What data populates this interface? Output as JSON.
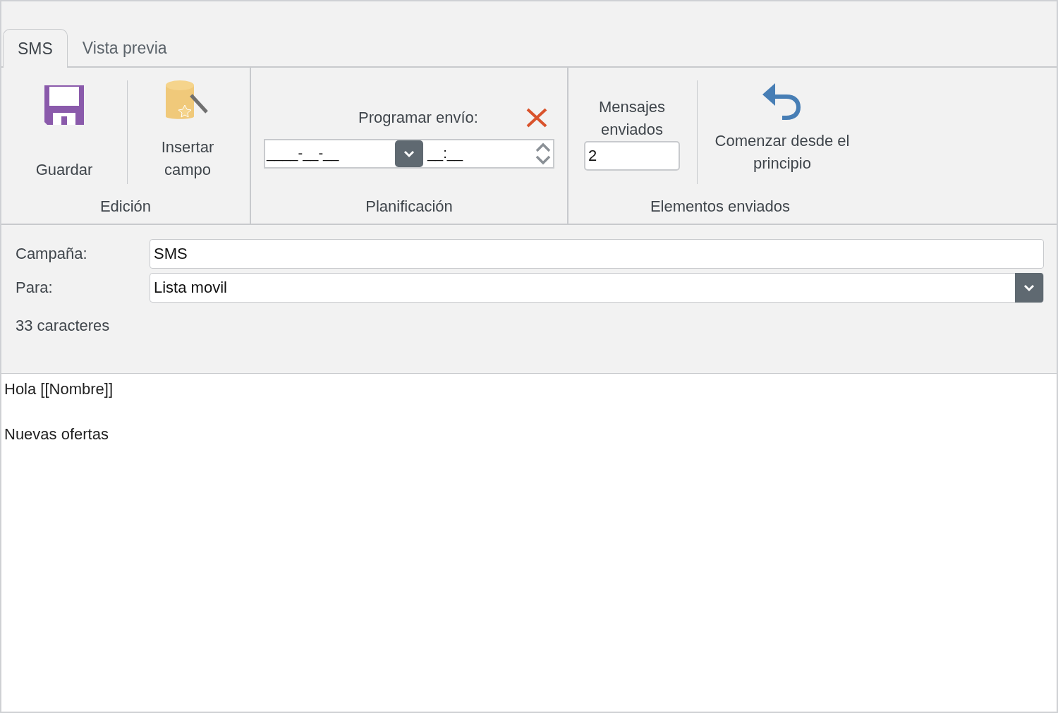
{
  "tabs": [
    {
      "label": "SMS",
      "selected": true
    },
    {
      "label": "Vista previa",
      "selected": false
    }
  ],
  "ribbon": {
    "groups": [
      {
        "kind": "edit",
        "label": "Edición",
        "buttons": [
          {
            "kind": "save",
            "label": "Guardar"
          },
          {
            "kind": "insert",
            "label": "Insertar campo"
          }
        ]
      },
      {
        "kind": "schedule",
        "label": "Planificación",
        "title": "Programar envío:",
        "date": "____-__-__",
        "time": "__:__"
      },
      {
        "kind": "sent",
        "label": "Elementos enviados",
        "counter_label": "Mensajes enviados",
        "counter_value": "2",
        "restart": "Comenzar desde el principio"
      }
    ]
  },
  "form": {
    "campaign_label": "Campaña:",
    "campaign": "SMS",
    "to_label": "Para:",
    "to": "Lista movil",
    "char_count": "33 caracteres"
  },
  "message": "Hola [[Nombre]]\n\nNuevas ofertas"
}
